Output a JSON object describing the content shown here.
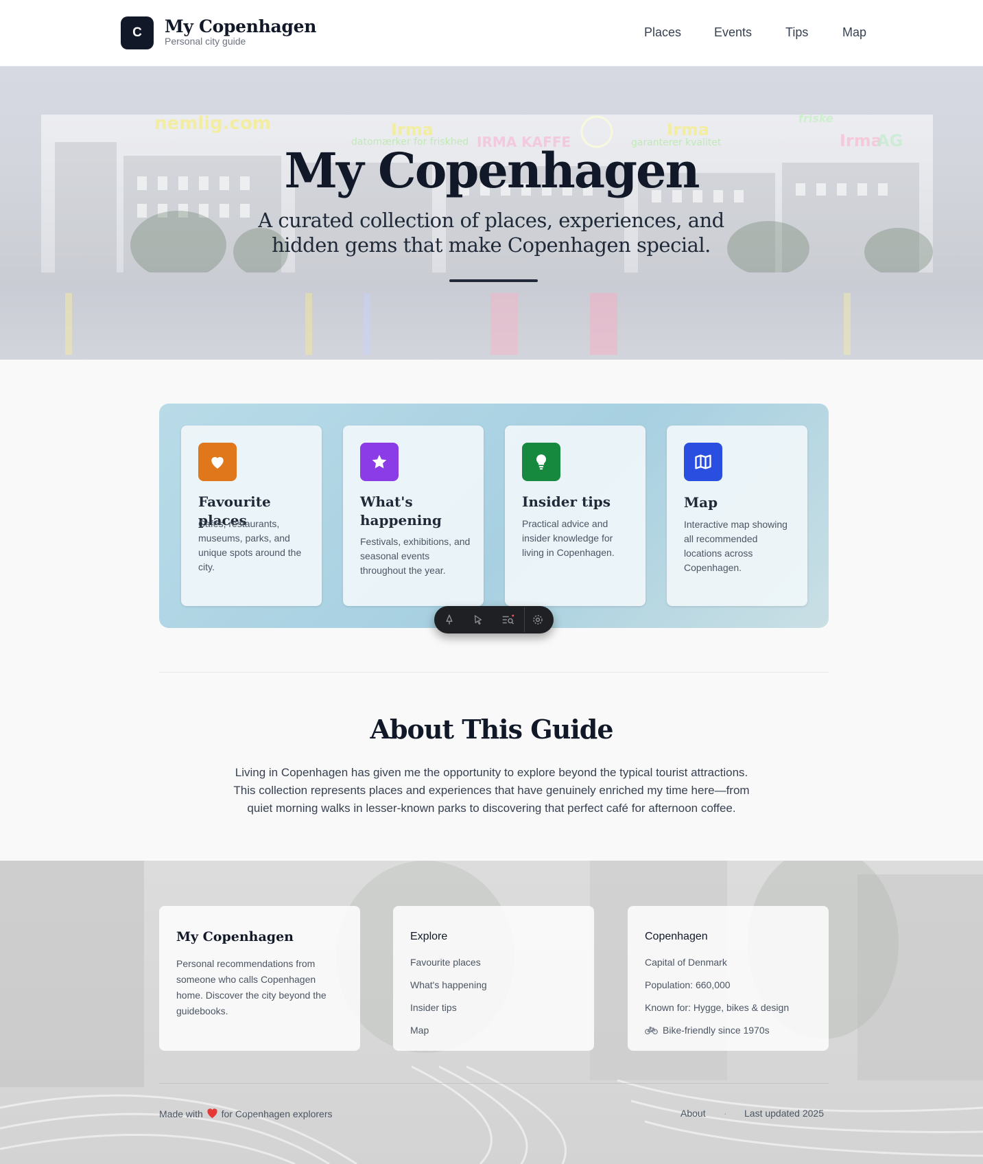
{
  "header": {
    "logo_letter": "C",
    "title": "My Copenhagen",
    "subtitle": "Personal city guide",
    "nav": [
      "Places",
      "Events",
      "Tips",
      "Map"
    ]
  },
  "hero": {
    "title": "My Copenhagen",
    "subtitle": "A curated collection of places, experiences, and hidden gems that make Copenhagen special.",
    "signs": [
      "nemlig.com",
      "Irma",
      "datomærker for friskhed",
      "IRMA KAFFE",
      "Irma",
      "garanterer kvalitet",
      "friske",
      "Irma",
      "AG"
    ]
  },
  "features": [
    {
      "title": "Favourite places",
      "description": "Cafés, restaurants, museums, parks, and unique spots around the city.",
      "icon": "heart-icon",
      "color": "#e0771a"
    },
    {
      "title": "What's happening",
      "description": "Festivals, exhibitions, and seasonal events throughout the year.",
      "icon": "star-icon",
      "color": "#8b3ce6"
    },
    {
      "title": "Insider tips",
      "description": "Practical advice and insider knowledge for living in Copenhagen.",
      "icon": "lightbulb-icon",
      "color": "#17893f"
    },
    {
      "title": "Map",
      "description": "Interactive map showing all recommended locations across Copenhagen.",
      "icon": "map-icon",
      "color": "#2a4fe0"
    }
  ],
  "toolbar": {
    "icons": [
      "pin-icon",
      "cursor-icon",
      "search-list-icon",
      "settings-icon"
    ]
  },
  "about": {
    "title": "About This Guide",
    "text": "Living in Copenhagen has given me the opportunity to explore beyond the typical tourist attractions. This collection represents places and experiences that have genuinely enriched my time here—from quiet morning walks in lesser-known parks to discovering that perfect café for afternoon coffee."
  },
  "footer": {
    "brand": {
      "title": "My Copenhagen",
      "text": "Personal recommendations from someone who calls Copenhagen home. Discover the city beyond the guidebooks."
    },
    "explore": {
      "title": "Explore",
      "links": [
        "Favourite places",
        "What's happening",
        "Insider tips",
        "Map"
      ]
    },
    "city": {
      "title": "Copenhagen",
      "facts": [
        "Capital of Denmark",
        "Population: 660,000",
        "Known for: Hygge, bikes & design",
        "Bike-friendly since 1970s"
      ]
    },
    "made_with_prefix": "Made with",
    "made_with_suffix": "for Copenhagen explorers",
    "about_link": "About",
    "separator": "·",
    "last_updated": "Last updated 2025",
    "heart_color": "#e53935"
  }
}
